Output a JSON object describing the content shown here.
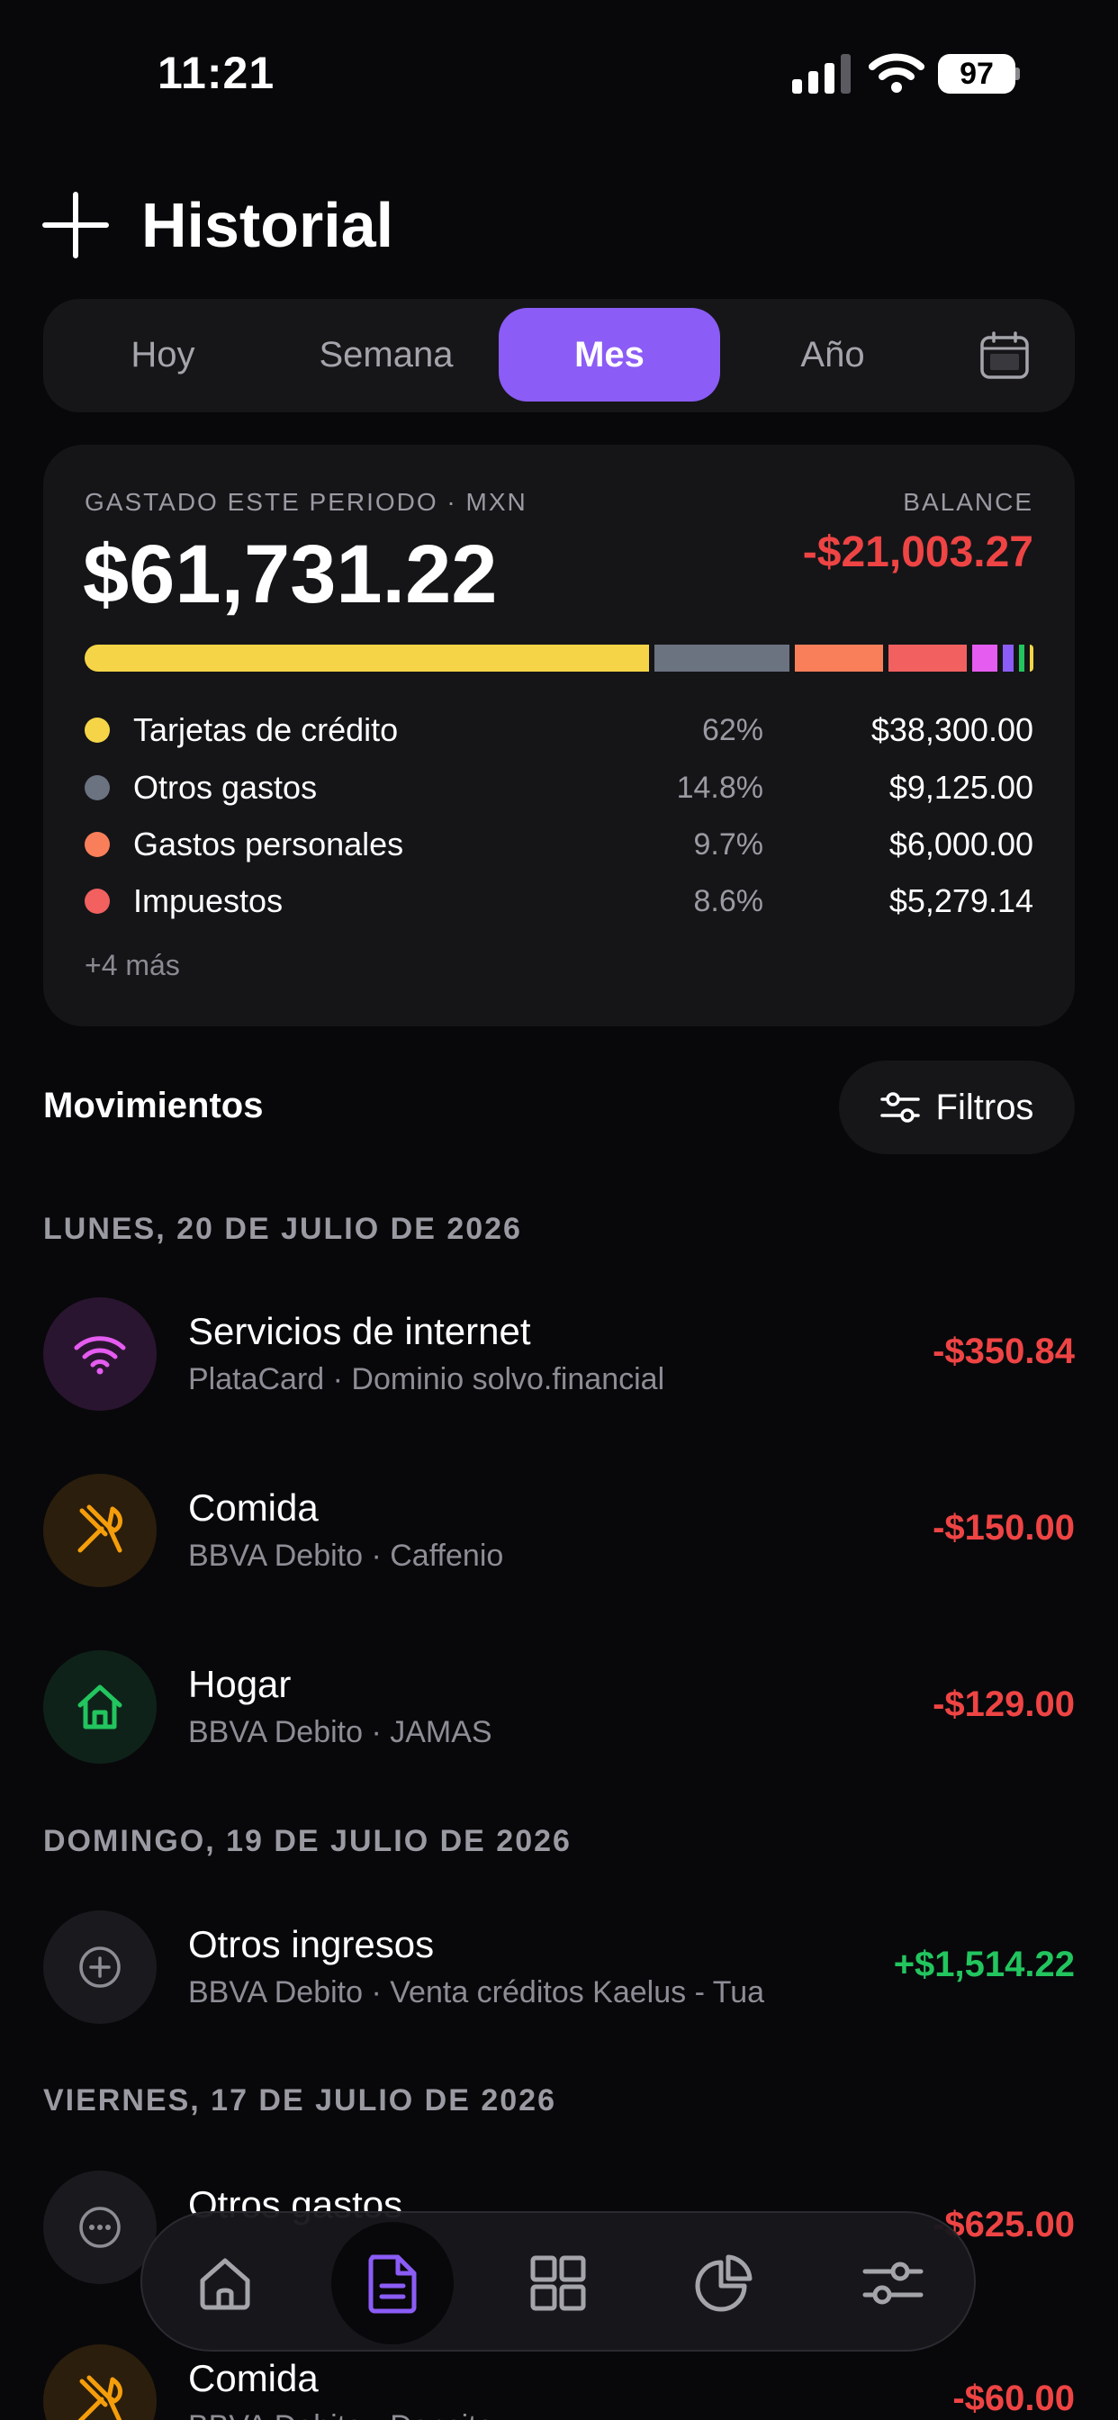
{
  "status_bar": {
    "time": "11:21",
    "battery": "97"
  },
  "header": {
    "title": "Historial"
  },
  "segments": {
    "items": [
      "Hoy",
      "Semana",
      "Mes",
      "Año"
    ],
    "active": "Mes"
  },
  "summary": {
    "period_label": "GASTADO ESTE PERIODO · MXN",
    "spent": "$61,731.22",
    "balance_label": "BALANCE",
    "balance": "-$21,003.27",
    "bar_segments": [
      {
        "pct": 62,
        "color": "#f5d547"
      },
      {
        "pct": 14.8,
        "color": "#6b7280"
      },
      {
        "pct": 9.7,
        "color": "#f97f5a"
      },
      {
        "pct": 8.6,
        "color": "#f26060"
      },
      {
        "pct": 2.8,
        "color": "#e45cf0"
      },
      {
        "pct": 1.2,
        "color": "#8b5cf6"
      },
      {
        "pct": 0.6,
        "color": "#22c55e"
      },
      {
        "pct": 0.3,
        "color": "#f5d547"
      }
    ],
    "categories": [
      {
        "name": "Tarjetas de crédito",
        "pct": "62%",
        "amount": "$38,300.00",
        "color": "#f5d547"
      },
      {
        "name": "Otros gastos",
        "pct": "14.8%",
        "amount": "$9,125.00",
        "color": "#6b7280"
      },
      {
        "name": "Gastos personales",
        "pct": "9.7%",
        "amount": "$6,000.00",
        "color": "#f97f5a"
      },
      {
        "name": "Impuestos",
        "pct": "8.6%",
        "amount": "$5,279.14",
        "color": "#f26060"
      }
    ],
    "more": "+4 más"
  },
  "movements": {
    "title": "Movimientos",
    "filters_label": "Filtros",
    "groups": [
      {
        "date": "LUNES, 20 DE JULIO DE 2026",
        "items": [
          {
            "icon": "wifi-icon",
            "title": "Servicios de internet",
            "sub": "PlataCard · Dominio solvo.financial",
            "amount": "-$350.84"
          },
          {
            "icon": "utensils-icon",
            "title": "Comida",
            "sub": "BBVA Debito · Caffenio",
            "amount": "-$150.00"
          },
          {
            "icon": "home-icon",
            "title": "Hogar",
            "sub": "BBVA Debito · JAMAS",
            "amount": "-$129.00"
          }
        ]
      },
      {
        "date": "DOMINGO, 19 DE JULIO DE 2026",
        "items": [
          {
            "icon": "plus-circle-icon",
            "title": "Otros ingresos",
            "sub": "BBVA Debito · Venta créditos Kaelus - Tua",
            "amount": "+$1,514.22"
          }
        ]
      },
      {
        "date": "VIERNES, 17 DE JULIO DE 2026",
        "items": [
          {
            "icon": "more-circle-icon",
            "title": "Otros gastos",
            "sub": "",
            "amount": "-$625.00"
          },
          {
            "icon": "utensils-icon",
            "title": "Comida",
            "sub": "BBVA Debito · Densito",
            "amount": "-$60.00"
          }
        ]
      }
    ]
  },
  "colors": {
    "accent": "#8b5cf6",
    "negative": "#ef4444",
    "positive": "#22c55e",
    "internet_icon": "#e45cf0",
    "food_icon": "#f59e0b",
    "home_icon": "#22c55e"
  }
}
